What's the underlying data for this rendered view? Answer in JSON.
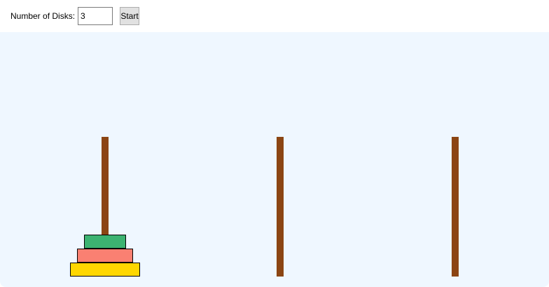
{
  "controls": {
    "disks_label": "Number of Disks:",
    "disks_value": "3",
    "start_label": "Start"
  },
  "board": {
    "peg_color": "#8b4513",
    "background_color": "#eff7ff",
    "pegs": [
      {
        "id": "peg-1",
        "disks": [
          3,
          2,
          1
        ]
      },
      {
        "id": "peg-2",
        "disks": []
      },
      {
        "id": "peg-3",
        "disks": []
      }
    ],
    "disk_colors": {
      "1": "#3cb371",
      "2": "#fa8072",
      "3": "#ffd700"
    }
  }
}
